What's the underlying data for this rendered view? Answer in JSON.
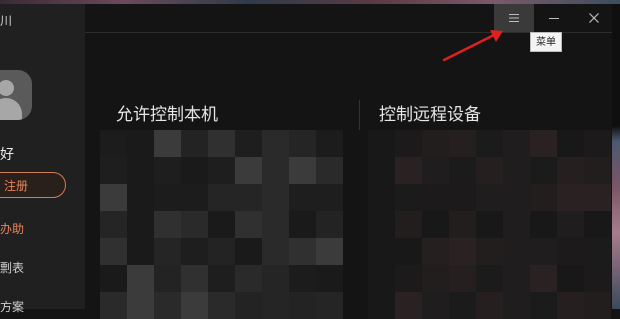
{
  "sidebar": {
    "app_glyph": "川",
    "greeting": "好",
    "register_label": "注册",
    "items": [
      {
        "label": "办助",
        "active": true
      },
      {
        "label": "剽表",
        "active": false
      },
      {
        "label": "方案",
        "active": false
      }
    ]
  },
  "titlebar": {
    "menu_tooltip": "菜单"
  },
  "main": {
    "allow_control_title": "允许控制本机",
    "remote_control_title": "控制远程设备"
  },
  "colors": {
    "accent": "#e8845a",
    "annotation_arrow": "#e02020"
  }
}
